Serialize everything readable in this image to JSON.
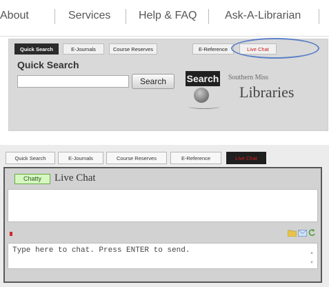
{
  "top_nav": {
    "items": [
      "About",
      "Services",
      "Help & FAQ",
      "Ask-A-Librarian"
    ]
  },
  "panel1": {
    "tabs": [
      "Quick Search",
      "E-Journals",
      "Course Reserves",
      "E-Reference",
      "Live Chat"
    ],
    "heading": "Quick Search",
    "search_input_value": "",
    "search_button": "Search",
    "logo": {
      "search_word": "Search",
      "line1": "Southern Miss",
      "line2": "Libraries"
    }
  },
  "panel2": {
    "tabs": [
      "Quick Search",
      "E-Journals",
      "Course Reserves",
      "E-Reference",
      "Live Chat"
    ],
    "chatty_badge": "Chatty",
    "title": "Live Chat",
    "input_placeholder": "Type here to chat. Press ENTER to send."
  },
  "colors": {
    "active_tab_dark": "#2b2b2b",
    "live_chat_red": "#c81818",
    "highlight_circle": "#5a7fc7",
    "chatty_green": "#d6f7c2"
  },
  "icons": [
    "sound-off-icon",
    "folder-icon",
    "mail-icon",
    "refresh-icon",
    "scroll-up-icon",
    "scroll-down-icon"
  ]
}
